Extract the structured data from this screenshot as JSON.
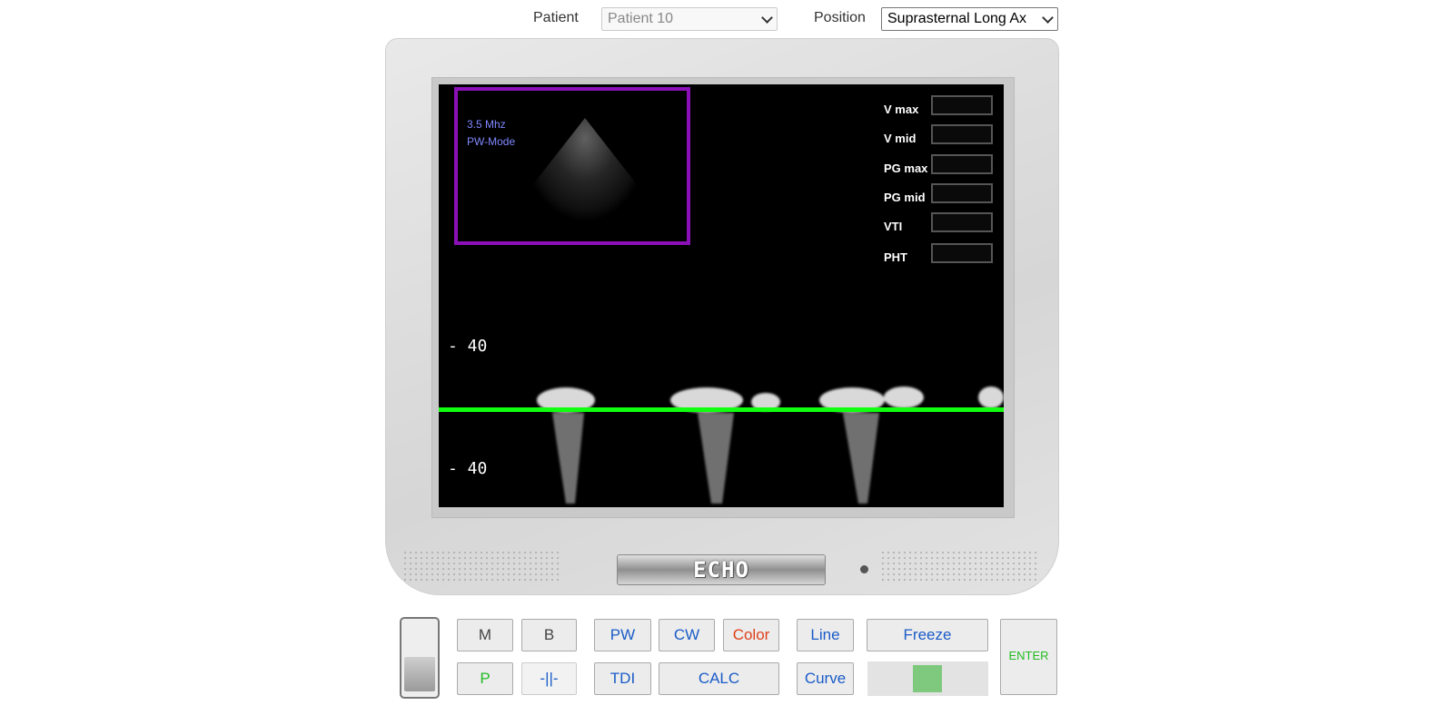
{
  "header": {
    "patient_label": "Patient",
    "patient_value": "Patient 10",
    "position_label": "Position",
    "position_value": "Suprasternal Long Ax"
  },
  "screen": {
    "frequency": "3.5 Mhz",
    "mode": "PW-Mode",
    "scale_top": "-  40",
    "scale_bottom": "-  40",
    "measurements": [
      {
        "label": "V max",
        "value": ""
      },
      {
        "label": "V mid",
        "value": ""
      },
      {
        "label": "PG max",
        "value": ""
      },
      {
        "label": "PG mid",
        "value": ""
      },
      {
        "label": "VTI",
        "value": ""
      },
      {
        "label": "PHT",
        "value": ""
      }
    ],
    "baseline_color": "#10ff10",
    "inset_border_color": "#8b10b8"
  },
  "device": {
    "brand": "ECHO"
  },
  "controls": {
    "m": "M",
    "b": "B",
    "pw": "PW",
    "cw": "CW",
    "color": "Color",
    "line": "Line",
    "freeze": "Freeze",
    "p": "P",
    "split": "-||-",
    "tdi": "TDI",
    "calc": "CALC",
    "curve": "Curve",
    "enter": "ENTER",
    "color_text_color": "#e0401a",
    "enter_text_color": "#22bb22",
    "p_text_color": "#22bb22"
  }
}
